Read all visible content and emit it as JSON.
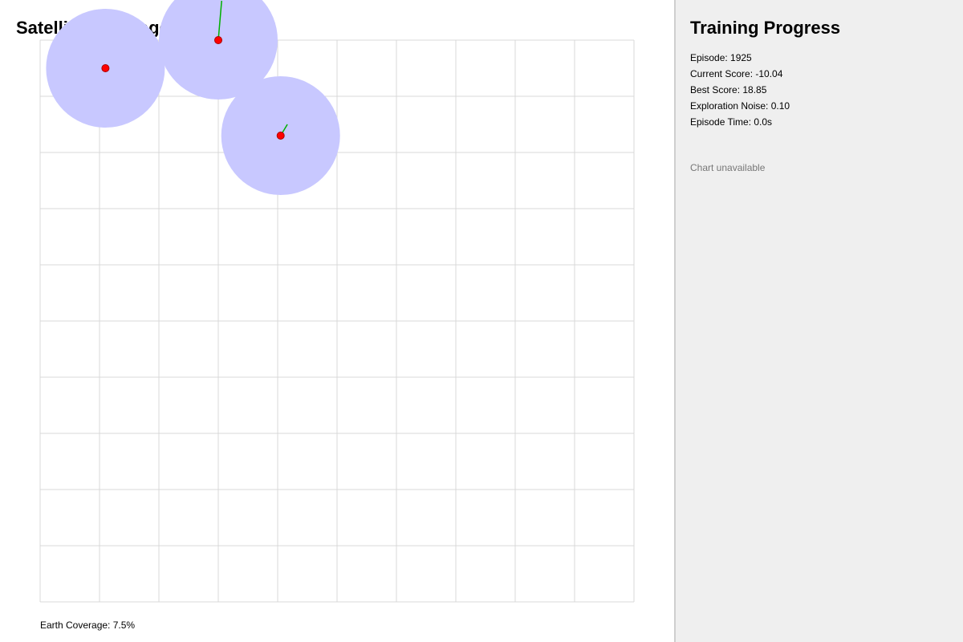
{
  "simulation": {
    "title": "Satellite Coverage Sim",
    "coverage_label": "Earth Coverage: 7.5%",
    "coverage_percent": 7.5,
    "grid": {
      "columns": 10,
      "rows": 10
    },
    "satellites": [
      {
        "id": "sat-1",
        "x": 1.1,
        "y": 0.5,
        "heading_x": 0,
        "heading_y": 0
      },
      {
        "id": "sat-2",
        "x": 3.0,
        "y": 0.0,
        "heading_x": 0.06,
        "heading_y": -0.7
      },
      {
        "id": "sat-3",
        "x": 4.05,
        "y": 1.7,
        "heading_x": 0.12,
        "heading_y": -0.2
      }
    ],
    "colors": {
      "coverage": "#c8c8ff",
      "satellite": "#ff0000",
      "satellite_edge": "#aa0000",
      "heading": "#00b000",
      "grid": "#d8d8d8"
    }
  },
  "panel": {
    "title": "Training Progress",
    "stats": [
      {
        "label": "Episode",
        "text": "Episode: 1925"
      },
      {
        "label": "Current Score",
        "text": "Current Score: -10.04"
      },
      {
        "label": "Best Score",
        "text": "Best Score: 18.85"
      },
      {
        "label": "Exploration Noise",
        "text": "Exploration Noise: 0.10"
      },
      {
        "label": "Episode Time",
        "text": "Episode Time: 0.0s"
      }
    ],
    "chart_status": "Chart unavailable"
  }
}
